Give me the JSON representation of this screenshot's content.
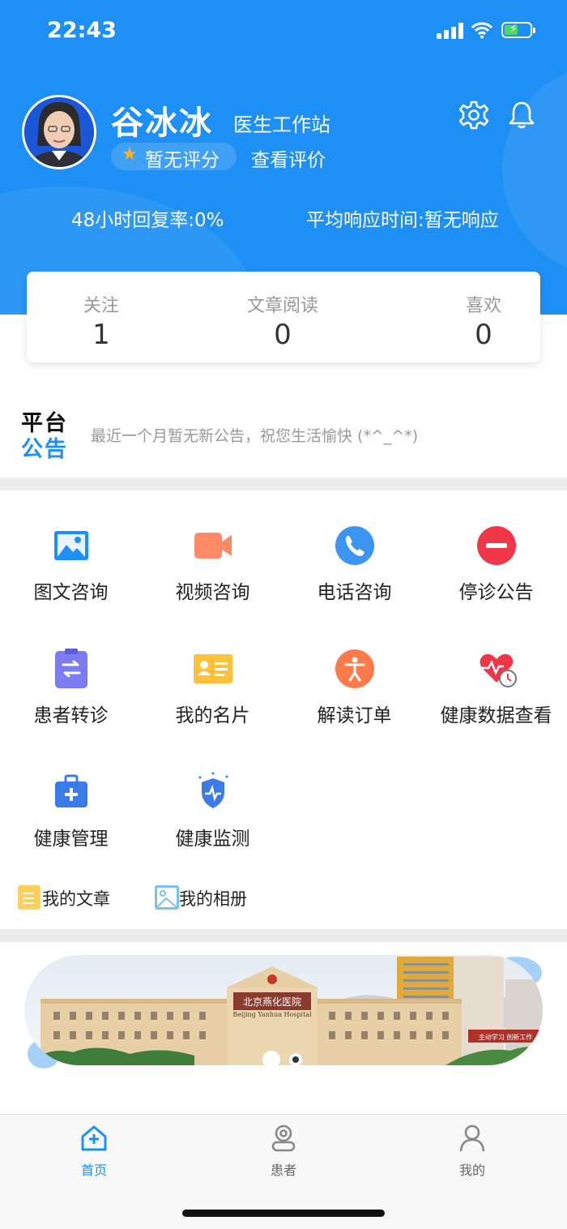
{
  "status_bar": {
    "time": "22:43"
  },
  "profile": {
    "name": "谷冰冰",
    "role": "医生工作站",
    "rating": "暂无评分",
    "view_reviews": "查看评价",
    "reply_rate": "48小时回复率:0%",
    "response_time": "平均响应时间:暂无响应"
  },
  "stats": [
    {
      "label": "关注",
      "value": "1"
    },
    {
      "label": "文章阅读",
      "value": "0"
    },
    {
      "label": "喜欢",
      "value": "0"
    }
  ],
  "notice": {
    "title_line1": "平台",
    "title_line2": "公告",
    "text": "最近一个月暂无新公告，祝您生活愉快 (*^_^*)"
  },
  "services": [
    {
      "label": "图文咨询",
      "icon": "image-icon"
    },
    {
      "label": "视频咨询",
      "icon": "video-camera-icon"
    },
    {
      "label": "电话咨询",
      "icon": "phone-icon"
    },
    {
      "label": "停诊公告",
      "icon": "stop-icon"
    },
    {
      "label": "患者转诊",
      "icon": "transfer-clipboard-icon"
    },
    {
      "label": "我的名片",
      "icon": "business-card-icon"
    },
    {
      "label": "解读订单",
      "icon": "person-icon"
    },
    {
      "label": "健康数据查看",
      "icon": "heart-gauge-icon"
    },
    {
      "label": "健康管理",
      "icon": "medical-kit-icon"
    },
    {
      "label": "健康监测",
      "icon": "shield-pulse-icon"
    }
  ],
  "quick_links": [
    {
      "label": "我的文章",
      "icon": "article-icon"
    },
    {
      "label": "我的相册",
      "icon": "album-icon"
    }
  ],
  "banner": {
    "sign_cn": "北京燕化医院",
    "sign_en": "Beijing Yanhua Hospital",
    "side_sign": "主动学习 创新工作"
  },
  "tabs": [
    {
      "label": "首页",
      "icon": "home-icon",
      "active": true
    },
    {
      "label": "患者",
      "icon": "patient-icon",
      "active": false
    },
    {
      "label": "我的",
      "icon": "user-icon",
      "active": false
    }
  ],
  "colors": {
    "primary": "#1e90f5",
    "stop_red": "#f0374a",
    "video_orange": "#ff8a65",
    "divider": "#ececec"
  }
}
